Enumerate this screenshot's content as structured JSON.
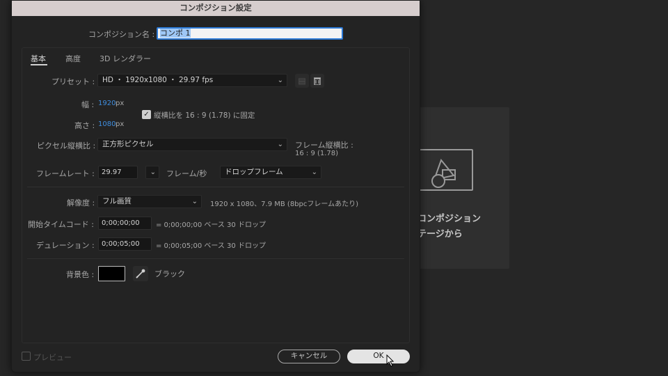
{
  "window": {
    "title": "コンポジション設定"
  },
  "background": {
    "text_line1": "コンポジション",
    "text_line2": "テージから"
  },
  "comp_name": {
    "label": "コンポジション名 :",
    "value": "コンポ 1"
  },
  "tabs": [
    {
      "label": "基本",
      "active": true
    },
    {
      "label": "高度",
      "active": false
    },
    {
      "label": "3D レンダラー",
      "active": false
    }
  ],
  "preset": {
    "label": "プリセット :",
    "value": "HD ・ 1920x1080 ・ 29.97 fps"
  },
  "width": {
    "label": "幅 :",
    "value": "1920",
    "unit": "px"
  },
  "height": {
    "label": "高さ :",
    "value": "1080",
    "unit": "px"
  },
  "lock_aspect": {
    "label": "縦横比を 16 : 9 (1.78) に固定",
    "checked": true
  },
  "pixel_aspect": {
    "label": "ピクセル縦横比 :",
    "value": "正方形ピクセル"
  },
  "frame_aspect": {
    "label": "フレーム縦横比 :",
    "value": "16 : 9 (1.78)"
  },
  "frame_rate": {
    "label": "フレームレート :",
    "value": "29.97",
    "unit": "フレーム/秒",
    "drop": "ドロップフレーム"
  },
  "resolution": {
    "label": "解像度 :",
    "value": "フル画質",
    "info": "1920 x 1080、7.9 MB (8bpcフレームあたり)"
  },
  "start_timecode": {
    "label": "開始タイムコード :",
    "value": "0;00;00;00",
    "info": "= 0;00;00;00  ベース 30   ドロップ"
  },
  "duration": {
    "label": "デュレーション :",
    "value": "0;00;05;00",
    "info": "= 0;00;05;00  ベース 30   ドロップ"
  },
  "bg_color": {
    "label": "背景色 :",
    "name": "ブラック",
    "color": "#000000"
  },
  "footer": {
    "preview_label": "プレビュー",
    "cancel_label": "キャンセル",
    "ok_label": "OK"
  },
  "colors": {
    "accent": "#2d7ad6",
    "value_blue": "#3f8ee0"
  }
}
